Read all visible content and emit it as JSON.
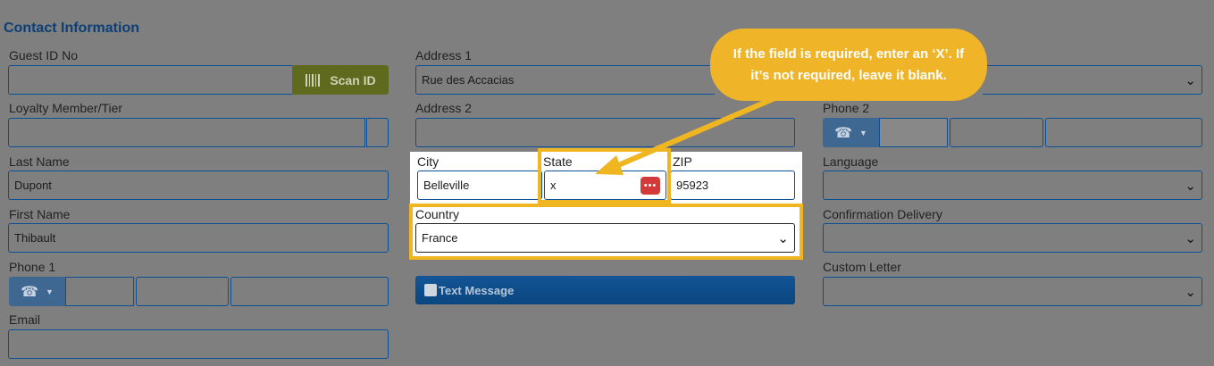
{
  "section_title": "Contact Information",
  "left": {
    "guest_id_label": "Guest ID No",
    "guest_id_value": "",
    "scan_label": "Scan ID",
    "loyalty_label": "Loyalty Member/Tier",
    "last_name_label": "Last Name",
    "last_name_value": "Dupont",
    "first_name_label": "First Name",
    "first_name_value": "Thibault",
    "phone1_label": "Phone 1",
    "email_label": "Email"
  },
  "middle": {
    "address1_label": "Address 1",
    "address1_value": "Rue des Accacias",
    "address2_label": "Address 2",
    "city_label": "City",
    "city_value": "Belleville",
    "state_label": "State",
    "state_value": "x",
    "zip_label": "ZIP",
    "zip_value": "95923",
    "country_label": "Country",
    "country_value": "France",
    "text_message_label": "Text Message"
  },
  "right": {
    "phone2_label": "Phone 2",
    "language_label": "Language",
    "confirmation_label": "Confirmation Delivery",
    "custom_letter_label": "Custom Letter"
  },
  "callout_text": "If the field is required, enter an ‘X’. If it’s not required, leave it blank.",
  "colors": {
    "overlay": "#7f7f7f",
    "accent_blue": "#0d4f95",
    "highlight": "#efb621",
    "scan_button": "#5f6a1e"
  },
  "icons": {
    "scan": "barcode-icon",
    "phone": "phone-icon",
    "password": "password-dots-icon"
  }
}
